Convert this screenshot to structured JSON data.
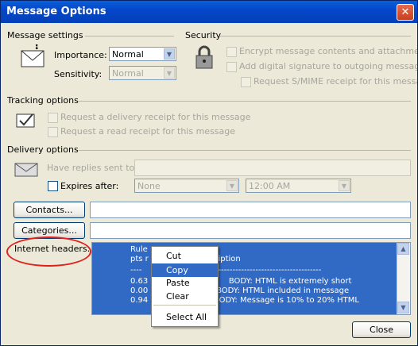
{
  "window": {
    "title": "Message Options",
    "close_symbol": "✕"
  },
  "message_settings": {
    "heading": "Message settings",
    "importance_label": "Importance:",
    "importance_value": "Normal",
    "sensitivity_label": "Sensitivity:",
    "sensitivity_value": "Normal"
  },
  "security": {
    "heading": "Security",
    "encrypt": "Encrypt message contents and attachments",
    "signature": "Add digital signature to outgoing message",
    "smime": "Request S/MIME receipt for this message"
  },
  "tracking": {
    "heading": "Tracking options",
    "delivery_receipt": "Request a delivery receipt for this message",
    "read_receipt": "Request a read receipt for this message"
  },
  "delivery": {
    "heading": "Delivery options",
    "replies_label": "Have replies sent to:",
    "expires_label": "Expires after:",
    "expires_date": "None",
    "expires_time": "12:00 AM"
  },
  "buttons": {
    "contacts": "Contacts...",
    "categories": "Categories...",
    "close": "Close"
  },
  "headers": {
    "label": "Internet headers:",
    "lines": [
      "Rule",
      "pts r                   description",
      "----                    ---------------------------------------------",
      "0.63                   NGTH    BODY: HTML is extremely short",
      "0.00                           BODY: HTML included in message",
      "0.94                          BODY: Message is 10% to 20% HTML"
    ]
  },
  "context_menu": {
    "cut": "Cut",
    "copy": "Copy",
    "paste": "Paste",
    "clear": "Clear",
    "select_all": "Select All"
  }
}
